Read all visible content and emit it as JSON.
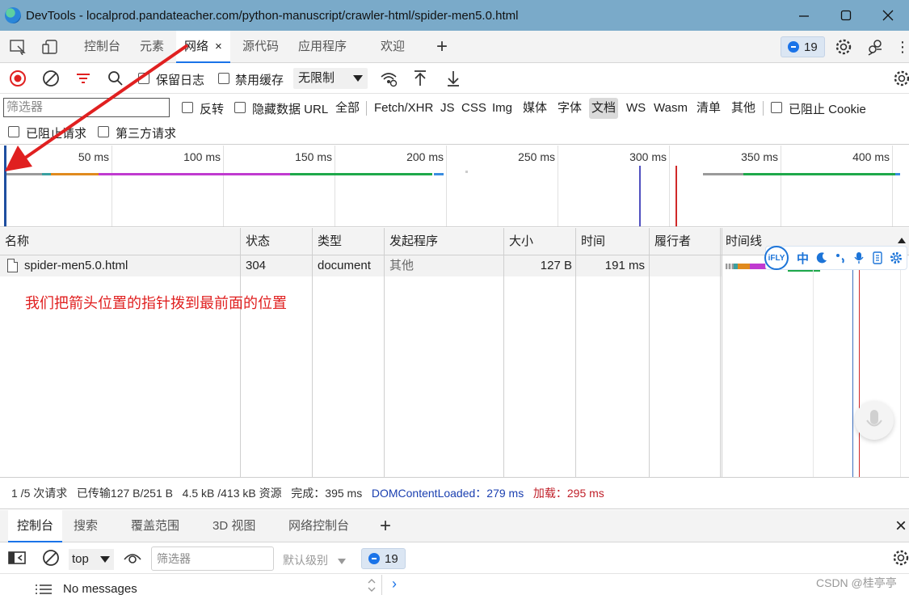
{
  "window": {
    "title": "DevTools - localprod.pandateacher.com/python-manuscript/crawler-html/spider-men5.0.html",
    "buttons": [
      "minimize-icon",
      "maximize-icon",
      "close-icon"
    ]
  },
  "tabs": {
    "items": [
      {
        "label": "控制台"
      },
      {
        "label": "元素"
      },
      {
        "label": "网络",
        "active": true,
        "close": "×"
      },
      {
        "label": "源代码"
      },
      {
        "label": "应用程序"
      },
      {
        "label": "欢迎"
      }
    ],
    "add": "+",
    "issues_count": "19",
    "more": "⋮"
  },
  "network_toolbar": {
    "preserve_log": "保留日志",
    "disable_cache": "禁用缓存",
    "throttling": "无限制"
  },
  "filter": {
    "placeholder": "筛选器",
    "invert": "反转",
    "hide_data_urls": "隐藏数据 URL",
    "types": [
      "全部",
      "Fetch/XHR",
      "JS",
      "CSS",
      "Img",
      "媒体",
      "字体",
      "文档",
      "WS",
      "Wasm",
      "清单",
      "其他"
    ],
    "active_type": "文档",
    "blocked_cookies": "已阻止 Cookie",
    "blocked_requests": "已阻止请求",
    "third_party": "第三方请求"
  },
  "overview": {
    "ticks": [
      "50 ms",
      "100 ms",
      "150 ms",
      "200 ms",
      "250 ms",
      "300 ms",
      "350 ms",
      "400 ms"
    ],
    "dom_content_loaded_color": "#3b3bb8",
    "load_color": "#d02828"
  },
  "table": {
    "columns": [
      "名称",
      "状态",
      "类型",
      "发起程序",
      "大小",
      "时间",
      "履行者",
      "时间线"
    ],
    "rows": [
      {
        "name": "spider-men5.0.html",
        "status": "304",
        "type": "document",
        "initiator": "其他",
        "size": "127 B",
        "time": "191 ms",
        "fulfilled_by": ""
      }
    ]
  },
  "annotation": {
    "text": "我们把箭头位置的指针拨到最前面的位置",
    "color": "#e02020"
  },
  "ifly": {
    "logo": "iFLY",
    "mode": "中"
  },
  "status": {
    "requests": "1 /5 次请求",
    "transferred": "已传输127 B/251 B",
    "resources": "4.5 kB /413 kB 资源",
    "finish": "完成：395 ms",
    "dcl": "DOMContentLoaded：279 ms",
    "load": "加载：295 ms"
  },
  "drawer": {
    "tabs": [
      "控制台",
      "搜索",
      "覆盖范围",
      "3D 视图",
      "网络控制台"
    ],
    "add": "+",
    "close": "×"
  },
  "console": {
    "context": "top",
    "filter_placeholder": "筛选器",
    "levels": "默认级别",
    "issues_count": "19",
    "messages": "No messages",
    "prompt": "›"
  },
  "watermark": "CSDN @桂亭亭",
  "colors": {
    "accent": "#1a73e8",
    "record": "#e02020",
    "titlebar": "#7aaac9"
  }
}
